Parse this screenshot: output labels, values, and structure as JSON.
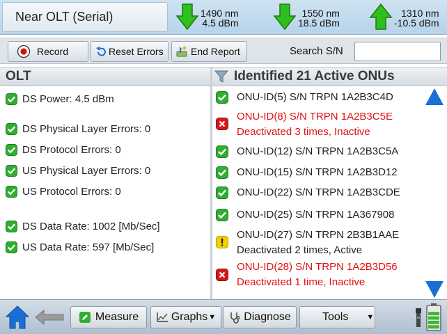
{
  "header": {
    "title": "Near OLT (Serial)",
    "wavelengths": [
      {
        "nm": "1490 nm",
        "power": "4.5 dBm",
        "direction": "down",
        "icon": "green-down-arrow-icon"
      },
      {
        "nm": "1550 nm",
        "power": "18.5 dBm",
        "direction": "down",
        "icon": "green-down-arrow-icon"
      },
      {
        "nm": "1310 nm",
        "power": "-10.5 dBm",
        "direction": "up",
        "icon": "green-up-arrow-icon"
      }
    ]
  },
  "toolbar": {
    "record_label": "Record",
    "reset_label": "Reset Errors",
    "end_report_label": "End Report",
    "search_label": "Search S/N",
    "search_value": ""
  },
  "olt": {
    "heading": "OLT",
    "items": [
      "DS Power: 4.5 dBm",
      "DS Physical Layer Errors: 0",
      "DS Protocol Errors: 0",
      "US Physical Layer Errors: 0",
      "US Protocol Errors: 0",
      "DS Data Rate: 1002 [Mb/Sec]",
      "US Data Rate: 597 [Mb/Sec]"
    ]
  },
  "onus": {
    "heading": "Identified 21 Active ONUs",
    "items": [
      {
        "status": "ok",
        "line1": "ONU-ID(5) S/N TRPN 1A2B3C4D",
        "line2": ""
      },
      {
        "status": "error",
        "line1": "ONU-ID(8) S/N TRPN 1A2B3C5E",
        "line2": "Deactivated 3 times, Inactive"
      },
      {
        "status": "ok",
        "line1": "ONU-ID(12) S/N TRPN 1A2B3C5A",
        "line2": ""
      },
      {
        "status": "ok",
        "line1": "ONU-ID(15) S/N TRPN 1A2B3D12",
        "line2": ""
      },
      {
        "status": "ok",
        "line1": "ONU-ID(22) S/N TRPN 1A2B3CDE",
        "line2": ""
      },
      {
        "status": "ok",
        "line1": "ONU-ID(25) S/N TRPN 1A367908",
        "line2": ""
      },
      {
        "status": "warning",
        "line1": "ONU-ID(27) S/N TRPN 2B3B1AAE",
        "line2": "Deactivated 2 times, Active"
      },
      {
        "status": "error",
        "line1": "ONU-ID(28) S/N TRPN 1A2B3D56",
        "line2": "Deactivated 1 time, Inactive"
      }
    ]
  },
  "bottom": {
    "measure_label": "Measure",
    "graphs_label": "Graphs",
    "diagnose_label": "Diagnose",
    "tools_label": "Tools",
    "battery_level": 0.85
  },
  "colors": {
    "ok": "#2fae2f",
    "error": "#e01010",
    "warning": "#f2d000",
    "scroll_arrow": "#1a6fd6",
    "arrow_green": "#2fbf1f"
  }
}
